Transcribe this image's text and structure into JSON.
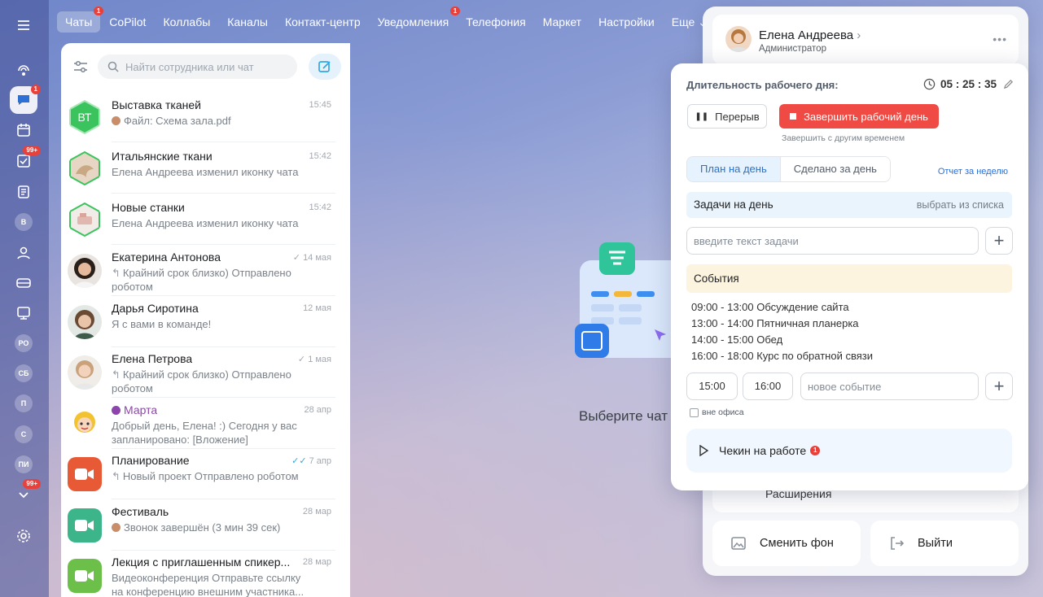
{
  "colors": {
    "accent": "#2d6fd4",
    "danger": "#ef4a43",
    "compose": "#2fa8e4"
  },
  "topnav": {
    "items": [
      {
        "label": "Чаты",
        "badge": "1"
      },
      {
        "label": "CoPilot"
      },
      {
        "label": "Коллабы"
      },
      {
        "label": "Каналы"
      },
      {
        "label": "Контакт-центр"
      },
      {
        "label": "Уведомления",
        "badge": "1"
      },
      {
        "label": "Телефония"
      },
      {
        "label": "Маркет"
      },
      {
        "label": "Настройки"
      },
      {
        "label": "Еще ⌄"
      }
    ]
  },
  "rail": {
    "chat_badge": "1",
    "tasks_badge": "99+",
    "bottom_badge": "99+",
    "circles": [
      "В",
      "РО",
      "СБ",
      "П",
      "С",
      "ПИ"
    ]
  },
  "search": {
    "placeholder": "Найти сотрудника или чат"
  },
  "chats": [
    {
      "name": "Выставка тканей",
      "time": "15:45",
      "msg": "Файл: Схема зала.pdf",
      "avatar_text": "ВТ"
    },
    {
      "name": "Итальянские ткани",
      "time": "15:42",
      "msg": "Елена Андреева изменил иконку чата"
    },
    {
      "name": "Новые станки",
      "time": "15:42",
      "msg": "Елена Андреева изменил иконку чата"
    },
    {
      "name": "Екатерина Антонова",
      "time": "14 мая",
      "msg": "Крайний срок близко) Отправлено роботом"
    },
    {
      "name": "Дарья Сиротина",
      "time": "12 мая",
      "msg": "Я с вами в команде!"
    },
    {
      "name": "Елена Петрова",
      "time": "1 мая",
      "msg": "Крайний срок близко) Отправлено роботом"
    },
    {
      "name": "Марта",
      "time": "28 апр",
      "msg": "Добрый день, Елена! :) Сегодня у вас запланировано: [Вложение]"
    },
    {
      "name": "Планирование",
      "time": "7 апр",
      "msg": "Новый проект Отправлено роботом"
    },
    {
      "name": "Фестиваль",
      "time": "28 мар",
      "msg": "Звонок завершён (3 мин 39 сек)"
    },
    {
      "name": "Лекция с приглашенным спикер...",
      "time": "28 мар",
      "msg": "Видеоконференция Отправьте ссылку на конференцию внешним участника..."
    }
  ],
  "center": {
    "title": "Выберите чат"
  },
  "profile": {
    "name": "Елена Андреева",
    "role": "Администратор",
    "extensions_label": "Расширения",
    "change_bg": "Сменить фон",
    "logout": "Выйти"
  },
  "workday": {
    "title": "Длительность рабочего дня:",
    "timer": "05 : 25 : 35",
    "pause": "Перерыв",
    "finish": "Завершить рабочий день",
    "finish_sub": "Завершить с другим временем",
    "tab_plan": "План на день",
    "tab_done": "Сделано за день",
    "week_report": "Отчет за неделю",
    "tasks_title": "Задачи на день",
    "tasks_pick": "выбрать из списка",
    "task_placeholder": "введите текст задачи",
    "events_title": "События",
    "events": [
      "09:00 - 13:00  Обсуждение сайта",
      "13:00 - 14:00  Пятничная планерка",
      "14:00 - 15:00  Обед",
      "16:00 - 18:00  Курс по обратной связи"
    ],
    "time_from": "15:00",
    "time_to": "16:00",
    "event_placeholder": "новое событие",
    "offsite": "вне офиса",
    "checkin": "Чекин на работе",
    "checkin_badge": "1"
  }
}
